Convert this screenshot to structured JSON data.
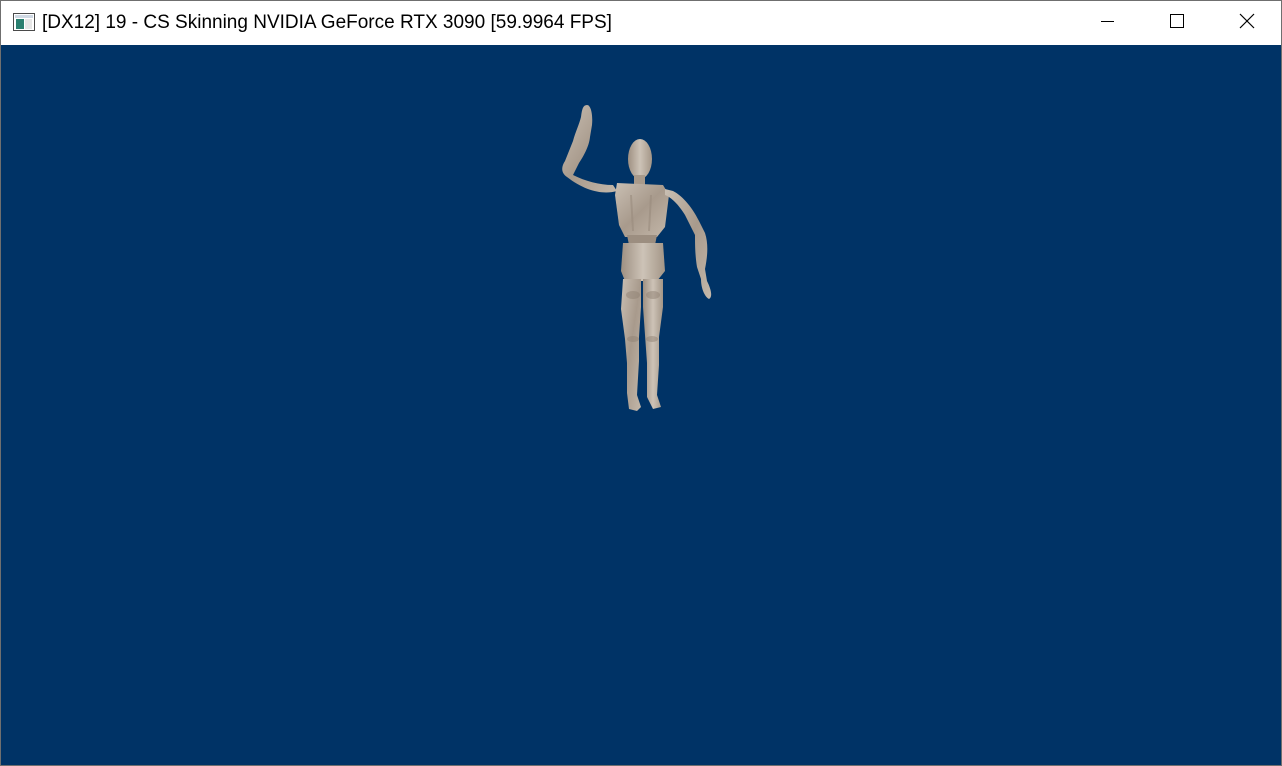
{
  "window": {
    "title": "[DX12] 19 - CS Skinning NVIDIA GeForce RTX 3090 [59.9964 FPS]",
    "icon": "app-window-icon"
  },
  "caption_buttons": {
    "minimize_icon": "minimize-icon",
    "maximize_icon": "maximize-icon",
    "close_icon": "close-icon"
  },
  "viewport": {
    "background_color": "#003366",
    "content": "skinned-mannequin-model",
    "model_color": "#bfb3a6"
  }
}
